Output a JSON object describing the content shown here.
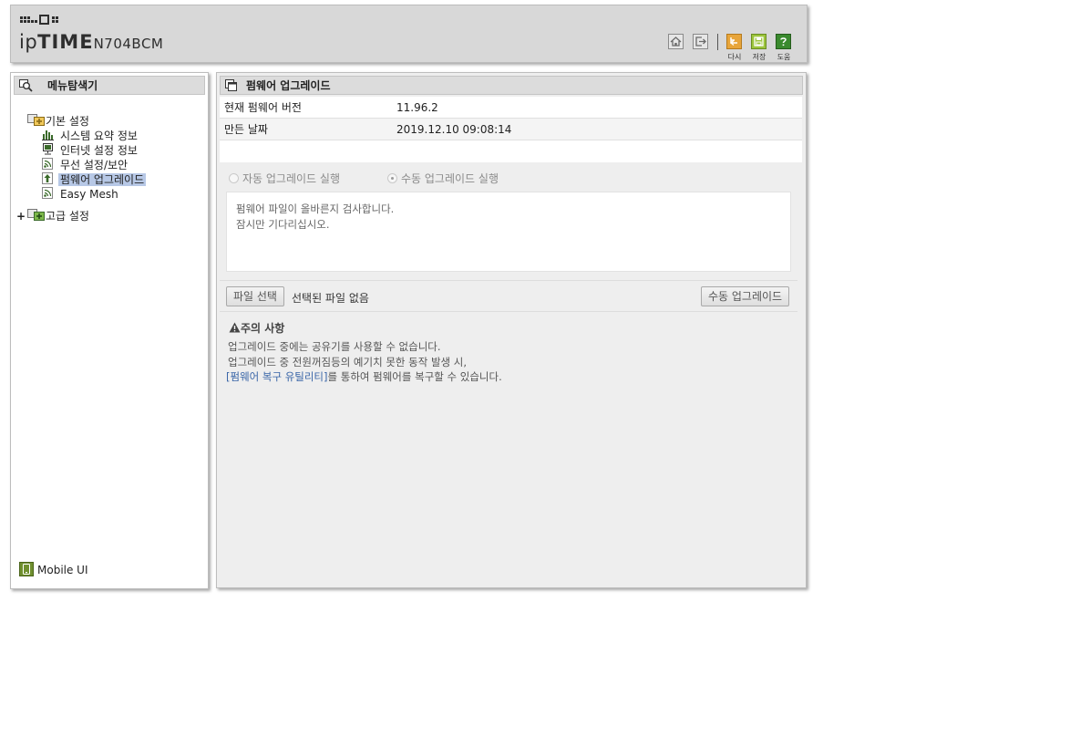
{
  "header": {
    "brand_prefix": "ip",
    "brand_main": "TIME",
    "model": "N704BCM",
    "buttons": {
      "back_label": "다시",
      "save_label": "저장",
      "help_label": "도움"
    },
    "colors": {
      "back": "#e8a53a",
      "save": "#9cc43c",
      "help": "#3a8a2e"
    }
  },
  "sidebar": {
    "title": "메뉴탐색기",
    "groups": [
      {
        "label": "기본 설정",
        "items": [
          {
            "label": "시스템 요약 정보",
            "icon": "bar-chart-icon"
          },
          {
            "label": "인터넷 설정 정보",
            "icon": "monitor-icon"
          },
          {
            "label": "무선 설정/보안",
            "icon": "wireless-icon"
          },
          {
            "label": "펌웨어 업그레이드",
            "icon": "upgrade-icon",
            "selected": true
          },
          {
            "label": "Easy Mesh",
            "icon": "wireless-icon"
          }
        ]
      },
      {
        "label": "고급 설정",
        "expand_symbol": "+"
      }
    ],
    "mobile_ui": "Mobile UI"
  },
  "main": {
    "title": "펌웨어 업그레이드",
    "info": [
      {
        "key": "현재 펌웨어 버전",
        "value": "11.96.2"
      },
      {
        "key": "만든 날짜",
        "value": "2019.12.10 09:08:14"
      }
    ],
    "radios": {
      "auto_label": "자동 업그레이드 실행",
      "manual_label": "수동 업그레이드 실행",
      "selected": "manual"
    },
    "message": {
      "line1": "펌웨어 파일이 올바른지 검사합니다.",
      "line2": "잠시만 기다리십시오."
    },
    "file": {
      "choose_label": "파일 선택",
      "status": "선택된 파일 없음",
      "manual_upgrade_label": "수동 업그레이드"
    },
    "caution": {
      "title": "주의 사항",
      "line1": "업그레이드 중에는 공유기를 사용할 수 없습니다.",
      "line2": "업그레이드 중 전원꺼짐등의 예기치 못한 동작 발생 시,",
      "link": "[펌웨어 복구 유틸리티]",
      "line3_rest": "를 통하여 펌웨어를 복구할 수 있습니다."
    }
  }
}
